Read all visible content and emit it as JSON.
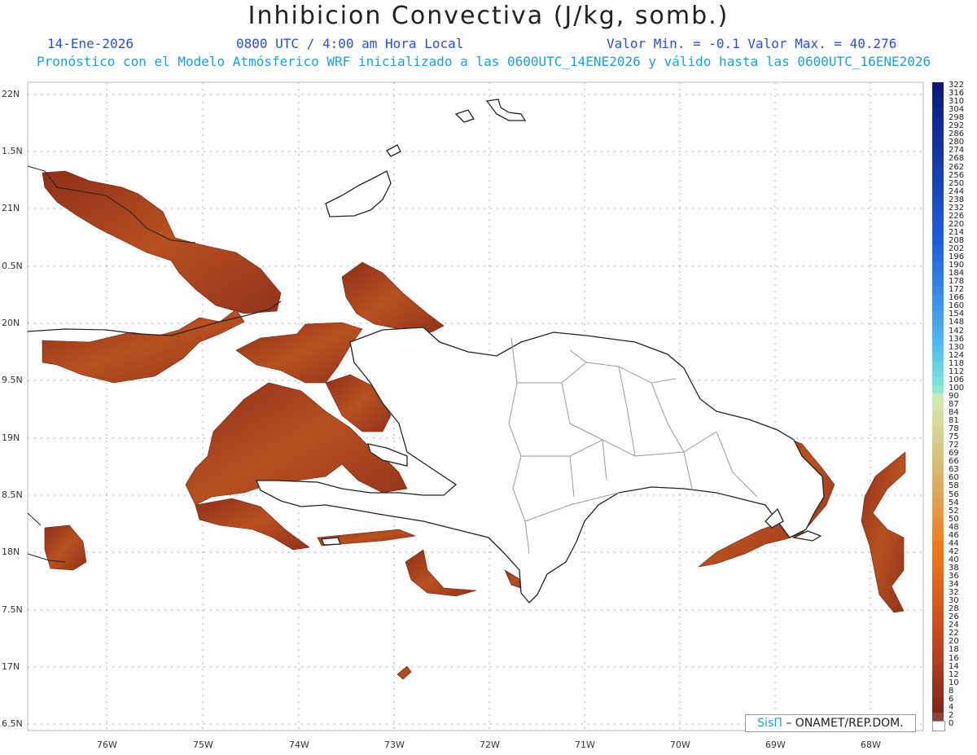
{
  "header": {
    "title": "Inhibicion Convectiva (J/kg, somb.)",
    "date": "14-Ene-2026",
    "time": "0800 UTC / 4:00 am Hora Local",
    "minmax": "Valor Min. = -0.1  Valor Max. = 40.276",
    "subtitle": "Pronóstico con el Modelo Atmósferico WRF inicializado a las 0600UTC_14ENE2026 y válido hasta las  0600UTC_16ENE2026"
  },
  "lat_labels": [
    "22N",
    "1.5N",
    "21N",
    "0.5N",
    "20N",
    "9.5N",
    "19N",
    "8.5N",
    "18N",
    "7.5N",
    "17N",
    "6.5N"
  ],
  "lon_labels": [
    "76W",
    "75W",
    "74W",
    "73W",
    "72W",
    "71W",
    "70W",
    "69W",
    "68W"
  ],
  "colorbar": {
    "labels": [
      "322",
      "316",
      "310",
      "304",
      "298",
      "292",
      "286",
      "280",
      "274",
      "268",
      "262",
      "256",
      "250",
      "244",
      "238",
      "232",
      "226",
      "220",
      "214",
      "208",
      "202",
      "196",
      "190",
      "184",
      "178",
      "172",
      "166",
      "160",
      "154",
      "148",
      "142",
      "136",
      "130",
      "124",
      "118",
      "112",
      "106",
      "100",
      "90",
      "87",
      "84",
      "81",
      "78",
      "75",
      "72",
      "69",
      "66",
      "63",
      "60",
      "58",
      "56",
      "54",
      "52",
      "50",
      "48",
      "46",
      "44",
      "42",
      "40",
      "38",
      "36",
      "34",
      "32",
      "30",
      "28",
      "26",
      "24",
      "22",
      "20",
      "18",
      "16",
      "14",
      "12",
      "10",
      "8",
      "6",
      "4",
      "2",
      "0"
    ],
    "colors": {
      "high": "#0a1a7a",
      "mid_blue": "#2f7ff0",
      "cyan": "#7fe8d8",
      "green": "#cde6a8",
      "orange": "#f07a1a",
      "brown": "#8a2a1a",
      "zero": "#ffffff"
    }
  },
  "credit": {
    "sis": "SisΠ",
    "rest": " – ONAMET/REP.DOM."
  },
  "field_color": "#a8401f"
}
